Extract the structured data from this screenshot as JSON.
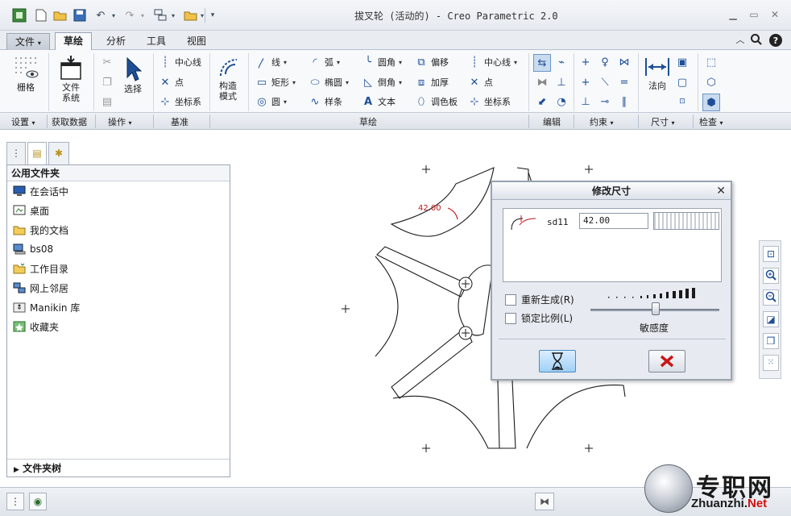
{
  "window": {
    "title": "拔叉轮 (活动的) - Creo Parametric 2.0"
  },
  "menu_tabs": [
    "文件",
    "草绘",
    "分析",
    "工具",
    "视图"
  ],
  "active_tab": "草绘",
  "ribbon": {
    "settings": {
      "grid": "栅格"
    },
    "get_data": {
      "file_system_l1": "文件",
      "file_system_l2": "系统"
    },
    "operations": {
      "select": "选择"
    },
    "datum": {
      "centerline": "中心线",
      "point": "点",
      "csys": "坐标系"
    },
    "sketch": {
      "construction_l1": "构造",
      "construction_l2": "模式",
      "line": "线",
      "rectangle": "矩形",
      "circle": "圆",
      "arc": "弧",
      "ellipse": "椭圆",
      "spline": "样条",
      "fillet": "圆角",
      "chamfer": "倒角",
      "text": "文本",
      "offset": "偏移",
      "thicken": "加厚",
      "palette": "调色板",
      "centerline": "中心线",
      "point": "点",
      "csys": "坐标系"
    },
    "dimension": {
      "normal": "法向"
    }
  },
  "groups": [
    "设置",
    "获取数据",
    "操作",
    "基准",
    "草绘",
    "编辑",
    "约束",
    "尺寸",
    "检查"
  ],
  "left_panel": {
    "header": "公用文件夹",
    "items": [
      {
        "label": "在会话中",
        "icon": "monitor-icon"
      },
      {
        "label": "桌面",
        "icon": "desktop-icon"
      },
      {
        "label": "我的文档",
        "icon": "folder-open-icon"
      },
      {
        "label": "bs08",
        "icon": "computer-icon"
      },
      {
        "label": "工作目录",
        "icon": "working-folder-icon"
      },
      {
        "label": "网上邻居",
        "icon": "network-icon"
      },
      {
        "label": "Manikin 库",
        "icon": "manikin-library-icon"
      },
      {
        "label": "收藏夹",
        "icon": "favorites-icon"
      }
    ],
    "footer": "文件夹树"
  },
  "graphics": {
    "dimension_value": "42.00"
  },
  "dialog": {
    "title": "修改尺寸",
    "dim_name": "sd11",
    "dim_value": "42.00",
    "regenerate": "重新生成",
    "regenerate_key": "(R)",
    "lock_scale": "锁定比例",
    "lock_scale_key": "(L)",
    "sensitivity": "敏感度"
  },
  "watermark": {
    "cn": "专职网",
    "en_main": "Zhuanzhi.",
    "en_suffix": "Net"
  },
  "colors": {
    "dim_red": "#c01818",
    "accent_blue": "#1e4f96",
    "cancel_red": "#c81818"
  }
}
